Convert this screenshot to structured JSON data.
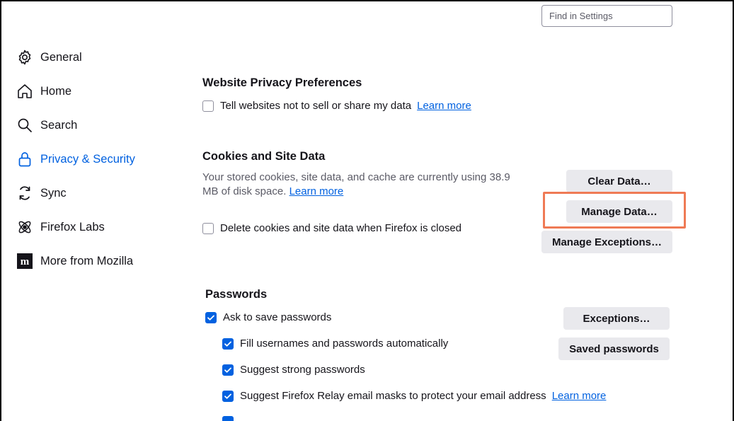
{
  "search": {
    "placeholder": "Find in Settings"
  },
  "sidebar": {
    "items": [
      {
        "label": "General",
        "icon": "gear-icon"
      },
      {
        "label": "Home",
        "icon": "home-icon"
      },
      {
        "label": "Search",
        "icon": "search-icon"
      },
      {
        "label": "Privacy & Security",
        "icon": "lock-icon",
        "active": true
      },
      {
        "label": "Sync",
        "icon": "sync-icon"
      },
      {
        "label": "Firefox Labs",
        "icon": "labs-icon"
      },
      {
        "label": "More from Mozilla",
        "icon": "mozilla-icon"
      }
    ]
  },
  "website_privacy": {
    "title": "Website Privacy Preferences",
    "checkbox_label": "Tell websites not to sell or share my data",
    "learn_more": "Learn more"
  },
  "cookies": {
    "title": "Cookies and Site Data",
    "desc_line1": "Your stored cookies, site data, and cache are currently using 38.9",
    "desc_line2": "MB of disk space.",
    "learn_more": "Learn more",
    "delete_label": "Delete cookies and site data when Firefox is closed",
    "clear_button": "Clear Data…",
    "manage_button": "Manage Data…",
    "exceptions_button": "Manage Exceptions…"
  },
  "passwords": {
    "title": "Passwords",
    "ask_save": "Ask to save passwords",
    "fill_auto": "Fill usernames and passwords automatically",
    "suggest_strong": "Suggest strong passwords",
    "suggest_relay": "Suggest Firefox Relay email masks to protect your email address",
    "learn_more": "Learn more",
    "exceptions_button": "Exceptions…",
    "saved_button": "Saved passwords"
  },
  "colors": {
    "accent": "#0061e0",
    "highlight": "#ef7a55",
    "button_bg": "#e9e9ed"
  }
}
